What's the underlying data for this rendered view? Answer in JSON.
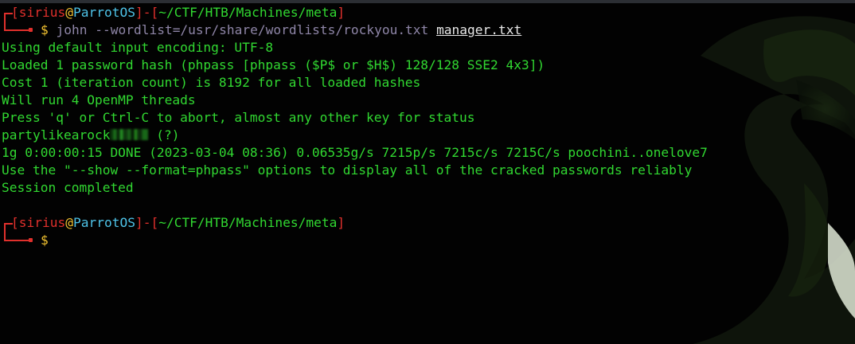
{
  "prompt1": {
    "user": "sirius",
    "at": "@",
    "host": "ParrotOS",
    "open_bracket": "[",
    "close_bracket": "]",
    "separator": "]-[",
    "path": "~/CTF/HTB/Machines/meta",
    "symbol": "$",
    "command": "john",
    "args": "--wordlist=/usr/share/wordlists/rockyou.txt",
    "file": "manager.txt"
  },
  "output": {
    "l1": "Using default input encoding: UTF-8",
    "l2": "Loaded 1 password hash (phpass [phpass ($P$ or $H$) 128/128 SSE2 4x3])",
    "l3": "Cost 1 (iteration count) is 8192 for all loaded hashes",
    "l4": "Will run 4 OpenMP threads",
    "l5": "Press 'q' or Ctrl-C to abort, almost any other key for status",
    "l6_prefix": "partylikearock",
    "l6_suffix": " (?)",
    "l7": "1g 0:00:00:15 DONE (2023-03-04 08:36) 0.06535g/s 7215p/s 7215c/s 7215C/s poochini..onelove7",
    "l8": "Use the \"--show --format=phpass\" options to display all of the cracked passwords reliably",
    "l9": "Session completed"
  },
  "prompt2": {
    "user": "sirius",
    "at": "@",
    "host": "ParrotOS",
    "open_bracket": "[",
    "close_bracket": "]",
    "separator": "]-[",
    "path": "~/CTF/HTB/Machines/meta",
    "symbol": "$"
  },
  "colors": {
    "background": "#020202",
    "output_green": "#31d831",
    "prompt_red": "#e0302c",
    "host_cyan": "#4ec3e8",
    "symbol_yellow": "#f2c230",
    "args_purple": "#8f86a8"
  },
  "icons": {
    "wallpaper": "parrot-logo-watermark",
    "redacted": "pixelated-blur"
  }
}
